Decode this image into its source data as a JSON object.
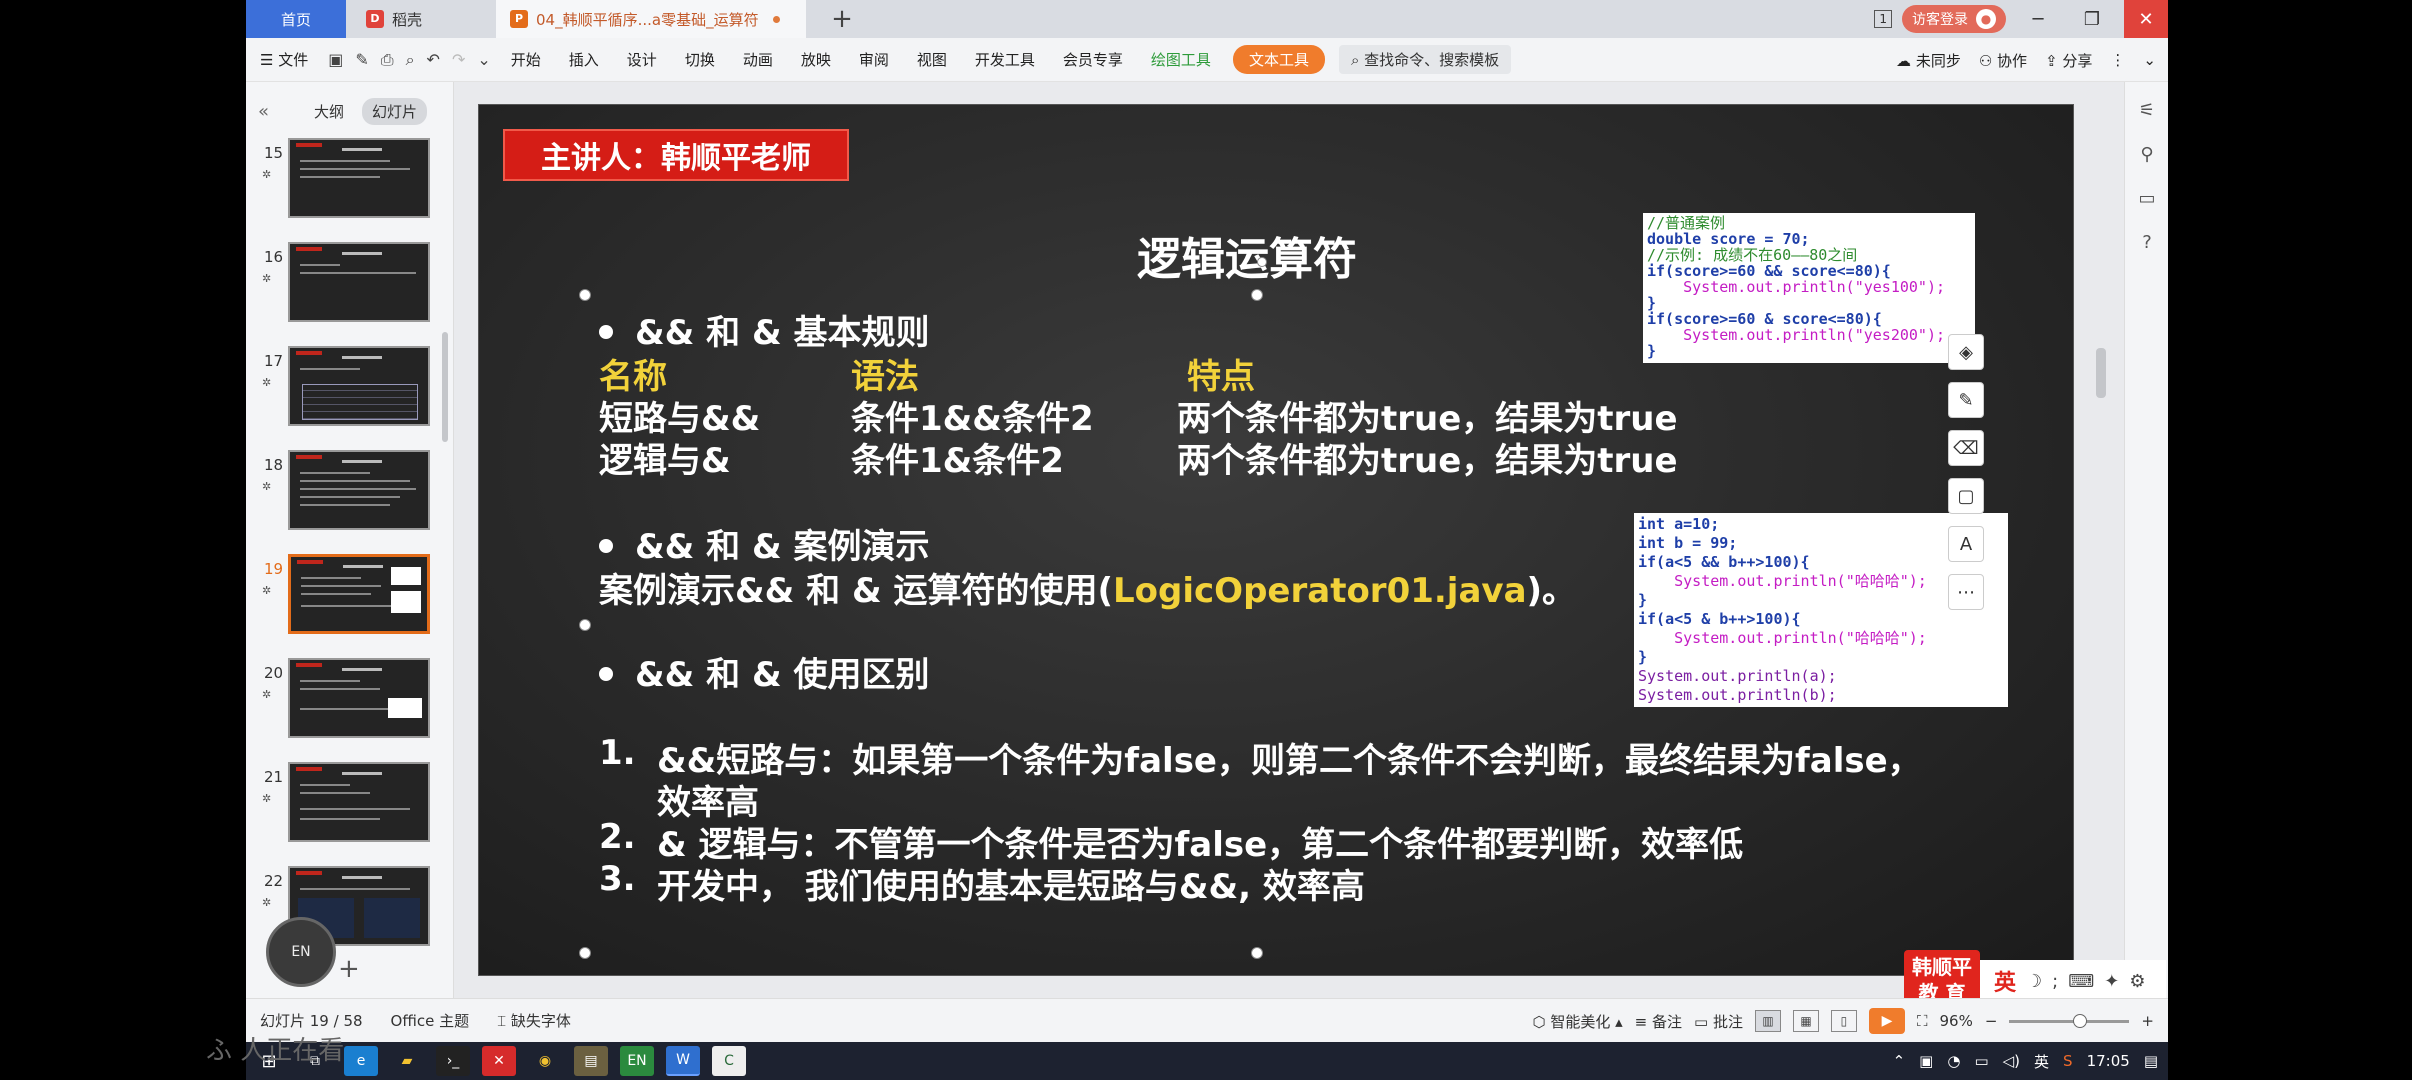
{
  "tabs": {
    "home": "首页",
    "daoke": "稻壳",
    "doc": "04_韩顺平循序...a零基础_运算符",
    "doc_icon": "P",
    "daoke_icon": "D"
  },
  "window": {
    "count": "1",
    "visitor_label": "访客登录",
    "minimize": "─",
    "restore": "❐",
    "close": "✕"
  },
  "ribbon": {
    "file": "文件",
    "items": [
      "开始",
      "插入",
      "设计",
      "切换",
      "动画",
      "放映",
      "审阅",
      "视图",
      "开发工具",
      "会员专享"
    ],
    "drawing_tools": "绘图工具",
    "text_tools": "文本工具",
    "search": "查找命令、搜索模板",
    "sync": "未同步",
    "collab": "协作",
    "share": "分享"
  },
  "left_panel": {
    "outline_tab": "大纲",
    "slides_tab": "幻灯片",
    "thumbnails": [
      "15",
      "16",
      "17",
      "18",
      "19",
      "20",
      "21",
      "22"
    ],
    "active_index": 4,
    "en_label": "EN"
  },
  "slide": {
    "speaker": "主讲人：韩顺平老师",
    "title": "逻辑运算符",
    "bullet1": "&& 和 & 基本规则",
    "col_name": "名称",
    "col_syntax": "语法",
    "col_feature": "特点",
    "row1_name": "短路与&&",
    "row1_syntax": "条件1&&条件2",
    "row1_feature": "两个条件都为true，结果为true",
    "row2_name": "逻辑与&",
    "row2_syntax": "条件1&条件2",
    "row2_feature": "两个条件都为true，结果为true",
    "bullet2": "&&  和 & 案例演示",
    "demo_prefix": "案例演示&& 和 & 运算符的使用(",
    "demo_file": "LogicOperator01.java",
    "demo_suffix": ")。",
    "bullet3": "&&  和 & 使用区别",
    "item1_num": "1.",
    "item1_text": "&&短路与：如果第一个条件为false，则第二个条件不会判断，最终结果为false，",
    "item1_cont": "效率高",
    "item2_num": "2.",
    "item2_text": "& 逻辑与：不管第一个条件是否为false，第二个条件都要判断，效率低",
    "item3_num": "3.",
    "item3_text": "开发中， 我们使用的基本是短路与&&, 效率高"
  },
  "code1": {
    "l1": "//普通案例",
    "l2": "double score = 70;",
    "l3": "//示例: 成绩不在60——80之间",
    "l4": "if(score>=60 && score<=80){",
    "l5": "    System.out.println(\"yes100\");",
    "l6": "}",
    "l7": "if(score>=60 & score<=80){",
    "l8": "    System.out.println(\"yes200\");",
    "l9": "}"
  },
  "code2": {
    "l1": "int a=10;",
    "l2": "int b = 99;",
    "l3": "if(a<5 && b++>100){",
    "l4": "    System.out.println(\"哈哈哈\");",
    "l5": "}",
    "l6": "if(a<5 & b++>100){",
    "l7": "    System.out.println(\"哈哈哈\");",
    "l8": "}",
    "l9": "System.out.println(a);",
    "l10": "System.out.println(b);"
  },
  "overlay": {
    "logo_line1": "韩顺平",
    "logo_line2": "教 育",
    "ime_lang": "英",
    "ime_moon": "☽"
  },
  "statusbar": {
    "slide_info": "幻灯片 19 / 58",
    "theme": "Office 主题",
    "missing_font": "缺失字体",
    "smart": "智能美化",
    "notes": "备注",
    "comments": "批注",
    "zoom": "96%"
  },
  "taskbar": {
    "time": "17:05",
    "lang": "英"
  },
  "watermark": "ふ 人正在看"
}
